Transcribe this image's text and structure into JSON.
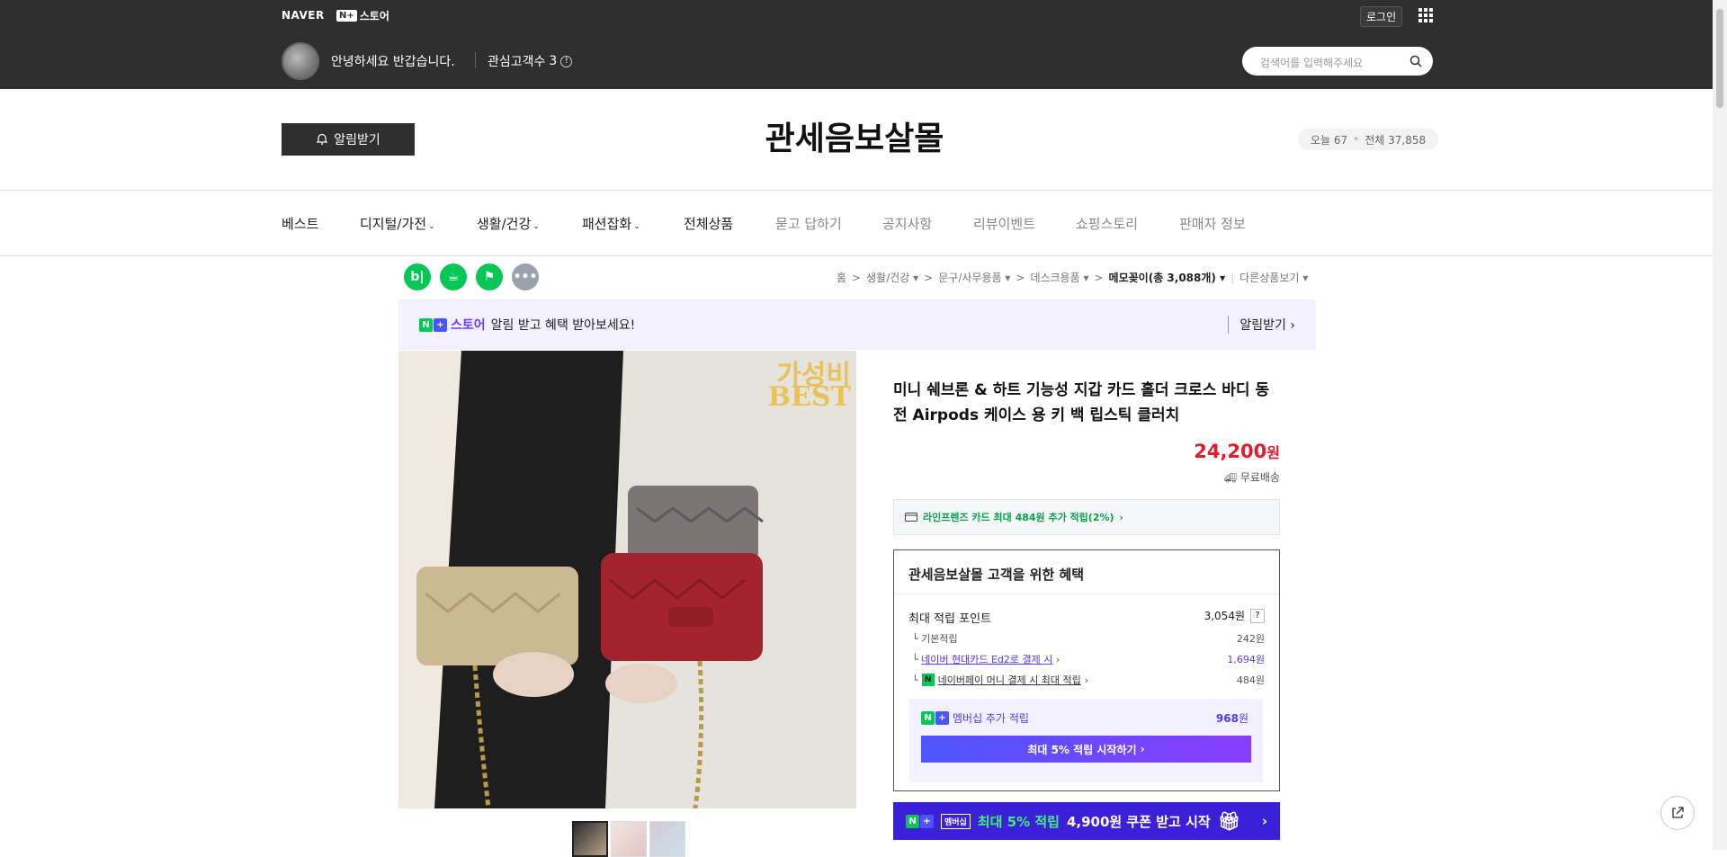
{
  "topbar": {
    "naver_logo": "NAVER",
    "nstore_badge": "N+",
    "nstore_label": "스토어",
    "login": "로그인",
    "greeting": "안녕하세요 반갑습니다.",
    "interest_label": "관심고객수",
    "interest_count": "3",
    "search_placeholder": "검색어를 입력해주세요"
  },
  "header": {
    "alarm_button": "알림받기",
    "shop_title": "관세음보살몰",
    "visitor_today": "오늘 67",
    "visitor_total": "전체 37,858"
  },
  "categories": [
    "베스트",
    "디지털/가전",
    "생활/건강",
    "패션잡화",
    "전체상품",
    "묻고 답하기",
    "공지사항",
    "리뷰이벤트",
    "쇼핑스토리",
    "판매자 정보"
  ],
  "breadcrumb": {
    "home": "홈",
    "c1": "생활/건강",
    "c2": "문구/사무용품",
    "c3": "데스크용품",
    "current": "메모꽂이(총 3,088개)",
    "other": "다른상품보기"
  },
  "banner": {
    "store": "스토어",
    "message": "알림 받고 혜택 받아보세요!",
    "action": "알림받기"
  },
  "product": {
    "image_overlay_1": "가성비",
    "image_overlay_2": "BEST",
    "name": "미니 쉐브론 & 하트 기능성 지갑 카드 홀더 크로스 바디 동전 Airpods 케이스 용 키 백 립스틱 클러치",
    "price": "24,200",
    "price_unit": "원",
    "shipping": "무료배송",
    "card_benefit": "라인프렌즈 카드 최대 484원 추가 적립(2%)"
  },
  "benefit": {
    "title": "관세음보살몰 고객을 위한 혜택",
    "max_point_label": "최대 적립 포인트",
    "max_point_value": "3,054원",
    "help": "?",
    "basic_label": "기본적립",
    "basic_value": "242원",
    "hyundai_label": "네이버 현대카드 Ed2로 결제 시",
    "hyundai_value": "1,694원",
    "npay_label": "네이버페이 머니 결제 시 최대 적립",
    "npay_value": "484원",
    "membership_label": "멤버십 추가 적립",
    "membership_value": "968",
    "membership_unit": "원",
    "start_button": "최대 5% 적립 시작하기"
  },
  "coupon": {
    "badge": "멤버십",
    "text": "최대 5% 적립",
    "text2": "4,900원 쿠폰 받고 시작"
  },
  "colors": {
    "topbar": "#2f2f2f",
    "price": "#e41a2f",
    "naver_green": "#06c755",
    "purple": "#6a3dff"
  }
}
